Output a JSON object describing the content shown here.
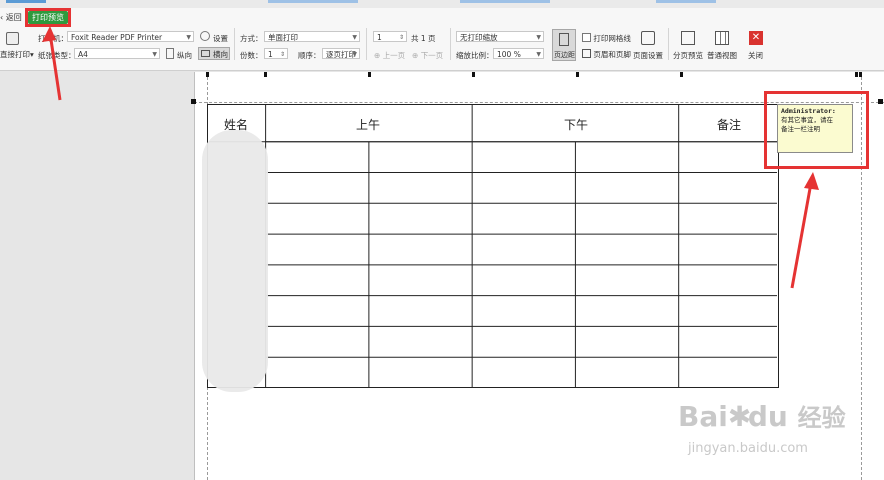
{
  "toolbar": {
    "back_label": "返回",
    "print_preview_tab": "打印预览",
    "direct_print_label": "直接打印",
    "printer_label": "打印机：",
    "printer_value": "Foxit Reader PDF Printer",
    "settings_label": "设置",
    "paper_type_label": "纸张类型：",
    "paper_type_value": "A4",
    "portrait_label": "纵向",
    "landscape_label": "横向",
    "mode_label": "方式：",
    "mode_value": "单面打印",
    "copies_label": "份数：",
    "copies_value": "1",
    "order_label": "顺序：",
    "order_value": "逐页打印",
    "page_value": "1",
    "total_pages": "共 1 页",
    "prev_page": "上一页",
    "next_page": "下一页",
    "scale_mode_value": "无打印缩放",
    "scale_label": "缩放比例：",
    "scale_value": "100 %",
    "margins_label": "页边距",
    "print_gridlines_label": "打印网格线",
    "header_footer_label": "页眉和页脚",
    "page_setup_label": "页面设置",
    "page_break_preview_label": "分页预览",
    "normal_view_label": "普通视图",
    "close_label": "关闭"
  },
  "sheet": {
    "headers": [
      "姓名",
      "上午",
      "下午",
      "备注"
    ],
    "data_rows": 8
  },
  "comment": {
    "author": "Administrator:",
    "line1": "有其它事宜，请在",
    "line2": "备注一栏注明"
  },
  "watermark": {
    "brand": "Bai",
    "brand2": "du",
    "suffix": "经验",
    "url": "jingyan.baidu.com"
  },
  "colors": {
    "accent_green": "#2e9a3e",
    "highlight_red": "#e53333",
    "comment_bg": "#fbfbd0"
  }
}
